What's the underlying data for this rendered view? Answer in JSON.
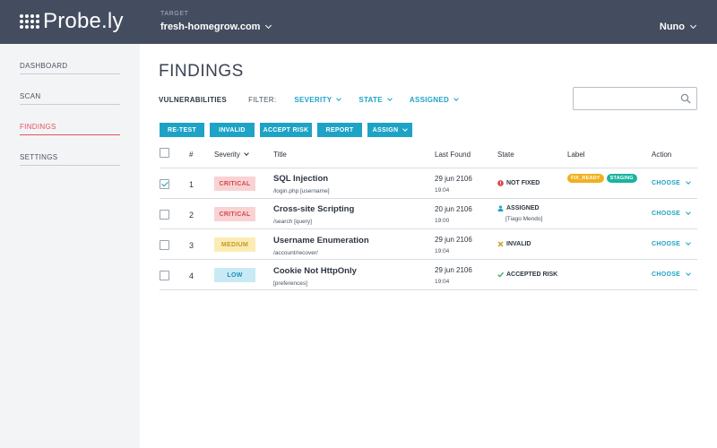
{
  "header": {
    "logo_text": "Probe.ly",
    "target_label": "TARGET",
    "target_value": "fresh-homegrow.com",
    "user_name": "Nuno"
  },
  "sidebar": {
    "items": [
      {
        "label": "DASHBOARD",
        "active": false
      },
      {
        "label": "SCAN",
        "active": false
      },
      {
        "label": "FINDINGS",
        "active": true
      },
      {
        "label": "SETTINGS",
        "active": false
      }
    ]
  },
  "main": {
    "title": "FINDINGS",
    "section_label": "VULNERABILITIES",
    "filter_label": "FILTER:",
    "filters": [
      "SEVERITY",
      "STATE",
      "ASSIGNED"
    ],
    "search_placeholder": ""
  },
  "actions": [
    "RE-TEST",
    "INVALID",
    "ACCEPT RISK",
    "REPORT",
    "ASSIGN"
  ],
  "table": {
    "headers": {
      "num": "#",
      "severity": "Severity",
      "title": "Title",
      "last_found": "Last Found",
      "state": "State",
      "label": "Label",
      "action": "Action"
    },
    "rows": [
      {
        "checked": true,
        "num": "1",
        "severity": "CRITICAL",
        "title": "SQL Injection",
        "path": "/login.php [username]",
        "date": "29 jun 2106",
        "time": "19:04",
        "state": "NOT FIXED",
        "state_sub": "",
        "labels": [
          "FIX_READY",
          "STAGING"
        ],
        "action": "CHOOSE"
      },
      {
        "checked": false,
        "num": "2",
        "severity": "CRITICAL",
        "title": "Cross-site Scripting",
        "path": "/search [query]",
        "date": "20 jun 2106",
        "time": "19:00",
        "state": "ASSIGNED",
        "state_sub": "[Tiago Mendo]",
        "labels": [],
        "action": "CHOOSE"
      },
      {
        "checked": false,
        "num": "3",
        "severity": "MEDIUM",
        "title": "Username Enumeration",
        "path": "/account/recover/",
        "date": "29 jun 2106",
        "time": "19:04",
        "state": "INVALID",
        "state_sub": "",
        "labels": [],
        "action": "CHOOSE"
      },
      {
        "checked": false,
        "num": "4",
        "severity": "LOW",
        "title": "Cookie Not HttpOnly",
        "path": "[preferences]",
        "date": "29 jun 2106",
        "time": "19:04",
        "state": "ACCEPTED RISK",
        "state_sub": "",
        "labels": [],
        "action": "CHOOSE"
      }
    ]
  },
  "colors": {
    "header_bg": "#444d5f",
    "accent": "#1ea3c6",
    "active_nav": "#e2525c",
    "critical_bg": "#f9d3d4",
    "critical_fg": "#d6474f",
    "medium_bg": "#fbecb5",
    "medium_fg": "#c99a1c",
    "low_bg": "#c9eaf5",
    "low_fg": "#1b8fb5",
    "label_fix_ready": "#f2b01e",
    "label_staging": "#1bb3a0"
  }
}
